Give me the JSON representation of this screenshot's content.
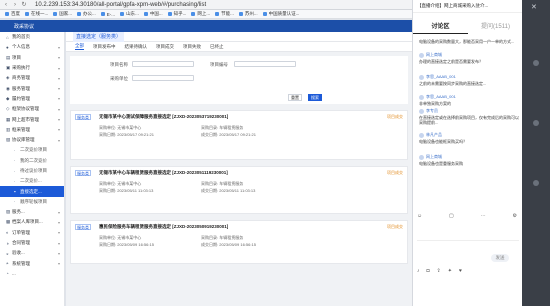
{
  "browser": {
    "url": "10.2.239.153:34.30180/all-portal/gpfa-xpm-web/#/purchasing/list",
    "bookmarks": [
      "百度",
      "在线一...",
      "国家...",
      "办公...",
      "E-...",
      "山东...",
      "中国...",
      "知乎...",
      "网上...",
      "节能...",
      "苏州...",
      "中国质量认证..."
    ]
  },
  "app": {
    "logo": "政采协议"
  },
  "sidebar": {
    "items": [
      {
        "label": "我的首页",
        "icon": "⌂",
        "sub": false,
        "active": false,
        "arrow": ""
      },
      {
        "label": "个人信息",
        "icon": "●",
        "sub": false,
        "active": false,
        "arrow": "▾"
      },
      {
        "label": "项目",
        "icon": "▤",
        "sub": false,
        "active": false,
        "arrow": "▾"
      },
      {
        "label": "采购执行",
        "icon": "▣",
        "sub": false,
        "active": false,
        "arrow": "▾"
      },
      {
        "label": "商务管理",
        "icon": "◈",
        "sub": false,
        "active": false,
        "arrow": "▾"
      },
      {
        "label": "服务管理",
        "icon": "◉",
        "sub": false,
        "active": false,
        "arrow": "▾"
      },
      {
        "label": "履约管理",
        "icon": "◆",
        "sub": false,
        "active": false,
        "arrow": "▾"
      },
      {
        "label": "框架协议管理",
        "icon": "◇",
        "sub": false,
        "active": false,
        "arrow": "▾"
      },
      {
        "label": "网上超市管理",
        "icon": "▦",
        "sub": false,
        "active": false,
        "arrow": "▾"
      },
      {
        "label": "框采管理",
        "icon": "▥",
        "sub": false,
        "active": false,
        "arrow": "▾"
      },
      {
        "label": "协议库管理",
        "icon": "▧",
        "sub": false,
        "active": false,
        "arrow": "▾"
      },
      {
        "label": "二次竞价项目",
        "icon": "·",
        "sub": true,
        "active": false,
        "arrow": ""
      },
      {
        "label": "我的二次竞价",
        "icon": "·",
        "sub": true,
        "active": false,
        "arrow": ""
      },
      {
        "label": "待过议价项目",
        "icon": "·",
        "sub": true,
        "active": false,
        "arrow": ""
      },
      {
        "label": "二次竞价...",
        "icon": "·",
        "sub": true,
        "active": false,
        "arrow": ""
      },
      {
        "label": "直接选定...",
        "icon": "▪",
        "sub": true,
        "active": true,
        "arrow": ""
      },
      {
        "label": "顺序轮候项目",
        "icon": "·",
        "sub": true,
        "active": false,
        "arrow": ""
      },
      {
        "label": "服务...",
        "icon": "▨",
        "sub": false,
        "active": false,
        "arrow": "▾"
      },
      {
        "label": "档案人库项目...",
        "icon": "▩",
        "sub": false,
        "active": false,
        "arrow": "▾"
      },
      {
        "label": "订单管理",
        "icon": "◐",
        "sub": false,
        "active": false,
        "arrow": "▾"
      },
      {
        "label": "合同管理",
        "icon": "◑",
        "sub": false,
        "active": false,
        "arrow": "▾"
      },
      {
        "label": "验收...",
        "icon": "◒",
        "sub": false,
        "active": false,
        "arrow": "▾"
      },
      {
        "label": "系统管理",
        "icon": "◓",
        "sub": false,
        "active": false,
        "arrow": "▾"
      },
      {
        "label": "...",
        "icon": "◔",
        "sub": false,
        "active": false,
        "arrow": ""
      }
    ]
  },
  "content": {
    "main_tab": "直接选定（服务类）",
    "subtabs": [
      {
        "label": "全部",
        "on": true
      },
      {
        "label": "项目发布中",
        "on": false
      },
      {
        "label": "结果待确认",
        "on": false
      },
      {
        "label": "项目成交",
        "on": false
      },
      {
        "label": "项目失败",
        "on": false
      },
      {
        "label": "已终止",
        "on": false
      }
    ],
    "filters": {
      "project_name_label": "项目名称",
      "project_code_label": "项目编号",
      "project_name_value": "",
      "project_code_value": "",
      "purchaser_label": "采购单位",
      "purchaser_value": "",
      "reset_label": "重置",
      "search_label": "搜索"
    },
    "cards": [
      {
        "tag": "服务类",
        "title": "无锡市某中心测试保障服务直接选定 [ZJXD-2023053719230001]",
        "status": "项目成交",
        "meta1": "采购单位: 无锡市某中心",
        "meta2": "采购日期: 2023/05/17 09:21:21",
        "meta3": "采购目录: 车辆租赁服务",
        "meta4": "成交日期: 2023/05/17 09:21:21"
      },
      {
        "tag": "服务类",
        "title": "无锡市某中心车辆租赁服务直接选定 [ZJXD-2023051119230001]",
        "status": "项目成交",
        "meta1": "采购单位: 无锡市某中心",
        "meta2": "采购日期: 2023/05/11 11:03:13",
        "meta3": "采购目录: 车辆租赁服务",
        "meta4": "成交日期: 2023/05/11 11:03:13"
      },
      {
        "tag": "服务类",
        "title": "惠民保险服务车辆租赁服务直接选定 [ZJXD-2023050919230001]",
        "status": "项目成交",
        "meta1": "采购单位: 无锡市某中心",
        "meta2": "采购日期: 2023/05/09 16:56:15",
        "meta3": "采购目录: 车辆租赁服务",
        "meta4": "成交日期: 2023/05/09 16:56:15"
      }
    ]
  },
  "chat": {
    "title": "【直播介绍】网上商城采购入驻介...",
    "tabs": [
      {
        "label": "讨论区",
        "on": true
      },
      {
        "label": "提问(1511)",
        "on": false
      }
    ],
    "messages": [
      {
        "who": "",
        "text": "电脑设备的采购数量大，那能否采用一户一单的方式..."
      },
      {
        "who": "网上商城",
        "text": "办理的直接选定之前是否需要发布？"
      },
      {
        "who": "李思_AAAB_001",
        "text": "之前的未需要按同步采购的直接选定..."
      },
      {
        "who": "李思_AAAB_001",
        "text": "非单独采购方案的"
      },
      {
        "who": "李专员",
        "text": "在直接选定或在选择前采购项目，仅有完成后的采购可以采购提前..."
      },
      {
        "who": "林凡产品",
        "text": "电脑设备也能框采购买吗？"
      },
      {
        "who": "网上商城",
        "text": "电脑设备也是重服务采购"
      }
    ],
    "send_label": "发送"
  }
}
